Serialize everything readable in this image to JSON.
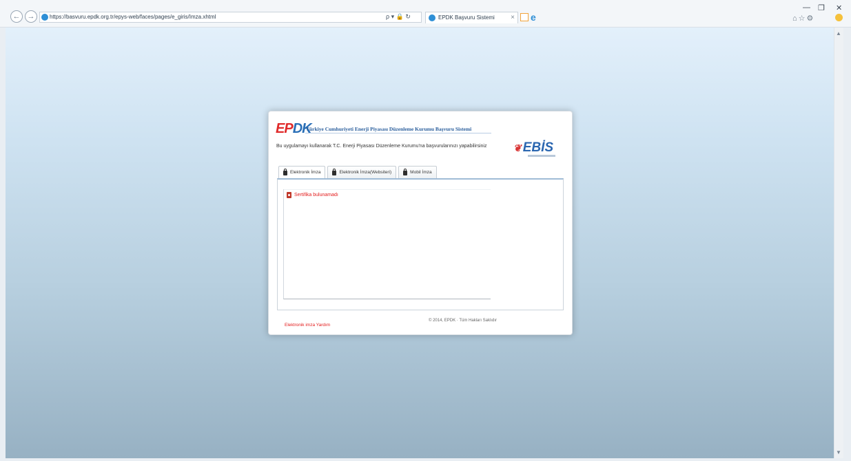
{
  "browser": {
    "url": "https://basvuru.epdk.org.tr/epys-web/faces/pages/e_giris/Imza.xhtml",
    "address_tools": "ρ ▾ 🔒 ↻",
    "tab_title": "EPDK Başvuru Sistemi",
    "tab_close": "×",
    "back": "←",
    "forward": "→",
    "min": "—",
    "restore": "❐",
    "close": "✕",
    "tool_icons": "⌂☆⚙"
  },
  "scrollbar": {
    "up": "▲",
    "down": "▼"
  },
  "app": {
    "logo_left": "EP",
    "logo_right": "DK",
    "header_title": "Türkiye Cumhuriyeti Enerji Piyasası Düzenleme Kurumu Başvuru Sistemi",
    "intro": "Bu uygulamayı kullanarak T.C. Enerji Piyasası Düzenleme Kurumu'na başvurularınızı yapabilirsiniz",
    "ebis_logo": "EBİS",
    "ebis_mark": "❦",
    "tabs": [
      {
        "label": "Elektronik İmza"
      },
      {
        "label": "Elektronik İmza(Websiteri)"
      },
      {
        "label": "Mobil İmza"
      }
    ],
    "error_message": "Sertifika bulunamadı",
    "help_link": "Elektronik imza Yardım",
    "copyright": "© 2014, EPDK · Tüm Hakları Saklıdır"
  }
}
